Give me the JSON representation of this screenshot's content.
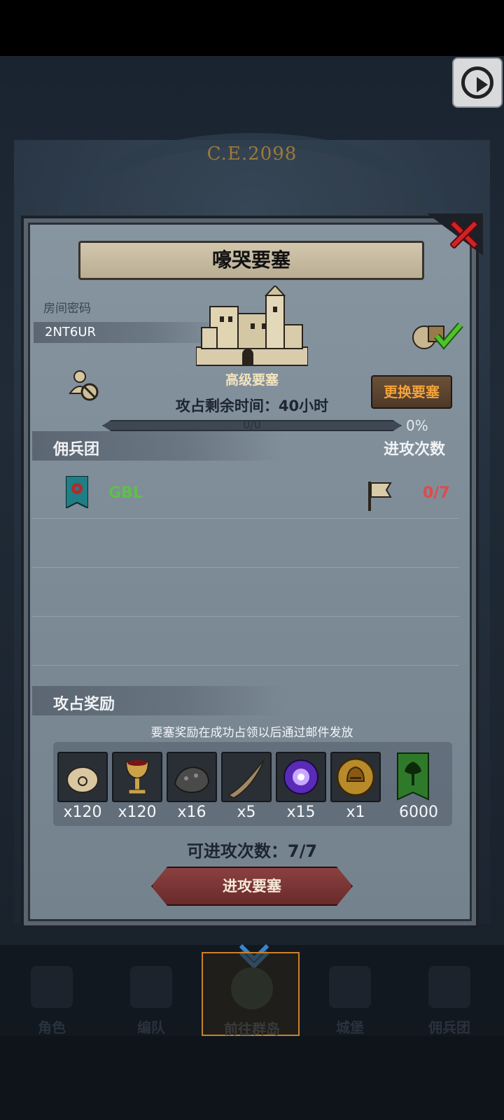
{
  "top_banner": {
    "era": "C.E.2098"
  },
  "play_button": {
    "icon": "play-icon"
  },
  "dialog": {
    "title": "嚎哭要塞",
    "room_code_label": "房间密码",
    "room_code_value": "2NT6UR",
    "fortress_name": "高级要塞",
    "time_remaining": "攻占剩余时间：40小时",
    "change_button": "更换要塞",
    "progress_text": "0/0",
    "progress_percent": "0%",
    "progress_fraction": 0
  },
  "mercenary_section": {
    "title": "佣兵团",
    "attacks_title": "进攻次数",
    "rows": [
      {
        "name": "GBL",
        "attack_count": "0/7"
      }
    ]
  },
  "rewards_section": {
    "title": "攻占奖励",
    "hint": "要塞奖励在成功占领以后通过邮件发放",
    "items": [
      {
        "icon": "sack-icon",
        "qty": "x120"
      },
      {
        "icon": "goblet-icon",
        "qty": "x120"
      },
      {
        "icon": "ore-icon",
        "qty": "x16"
      },
      {
        "icon": "horn-icon",
        "qty": "x5"
      },
      {
        "icon": "purple-crystal-icon",
        "qty": "x15"
      },
      {
        "icon": "helmet-coin-icon",
        "qty": "x1"
      },
      {
        "icon": "tree-banner-icon",
        "qty": "6000"
      }
    ]
  },
  "remaining_attacks": "可进攻次数：7/7",
  "attack_button": "进攻要塞",
  "bottom_nav": [
    {
      "label": "角色",
      "icon": "knight-icon",
      "active": false
    },
    {
      "label": "编队",
      "icon": "formation-icon",
      "active": false
    },
    {
      "label": "前往群岛",
      "icon": "islands-icon",
      "active": true
    },
    {
      "label": "城堡",
      "icon": "castle-icon",
      "active": false
    },
    {
      "label": "佣兵团",
      "icon": "mercenary-icon",
      "active": false
    }
  ]
}
